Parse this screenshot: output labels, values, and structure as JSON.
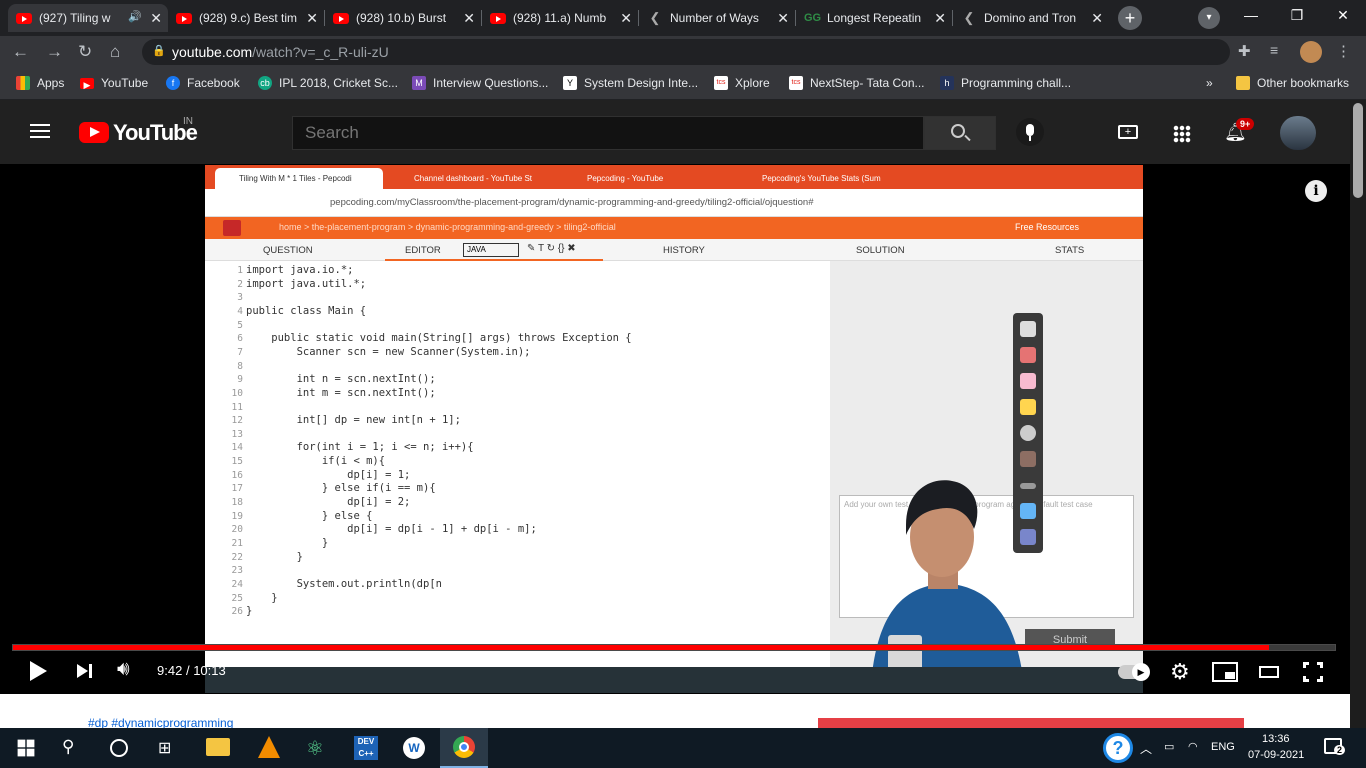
{
  "browser": {
    "tabs": [
      {
        "title": "(927) Tiling w",
        "icon": "youtube-icon"
      },
      {
        "title": "(928) 9.c) Best tim",
        "icon": "youtube-icon"
      },
      {
        "title": "(928) 10.b) Burst",
        "icon": "youtube-icon"
      },
      {
        "title": "(928) 11.a) Numb",
        "icon": "youtube-icon"
      },
      {
        "title": "Number of Ways",
        "icon": "pepcoding-icon"
      },
      {
        "title": "Longest Repeatin",
        "icon": "geeksforgeeks-icon"
      },
      {
        "title": "Domino and Tron",
        "icon": "pepcoding-icon"
      }
    ],
    "url_host": "youtube.com",
    "url_path": "/watch?v=_c_R-uli-zU",
    "bookmarks": [
      {
        "label": "Apps",
        "color": "#e8eaed"
      },
      {
        "label": "YouTube",
        "color": "#ff0000"
      },
      {
        "label": "Facebook",
        "color": "#1877f2"
      },
      {
        "label": "IPL 2018, Cricket Sc...",
        "color": "#11a683"
      },
      {
        "label": "Interview Questions...",
        "color": "#7b4bb7"
      },
      {
        "label": "System Design Inte...",
        "color": "#ffffff"
      },
      {
        "label": "Xplore",
        "color": "#e2231a"
      },
      {
        "label": "NextStep- Tata Con...",
        "color": "#e2231a"
      },
      {
        "label": "Programming chall...",
        "color": "#24335a"
      }
    ],
    "more_bookmarks": "»",
    "other_bookmarks": "Other bookmarks"
  },
  "youtube": {
    "logo_text": "YouTube",
    "region": "IN",
    "search_placeholder": "Search",
    "notification_badge": "9+",
    "time_current": "9:42",
    "time_sep": "/",
    "time_total": "10:13",
    "progress_fraction": 0.95,
    "hashtags": "#dp #dynamicprogramming"
  },
  "video": {
    "tabs": [
      "Tiling With M * 1 Tiles - Pepcodi",
      "Channel dashboard - YouTube St",
      "Pepcoding - YouTube",
      "Pepcoding's YouTube Stats (Sum"
    ],
    "url": "pepcoding.com/myClassroom/the-placement-program/dynamic-programming-and-greedy/tiling2-official/ojquestion#",
    "breadcrumb": "home > the-placement-program > dynamic-programming-and-greedy > tiling2-official",
    "free_resources": "Free Resources",
    "sub_tabs": [
      "QUESTION",
      "EDITOR",
      "HISTORY",
      "SOLUTION",
      "STATS"
    ],
    "language": "JAVA",
    "stdin_placeholder": "Add your own test cases or run your program against default test case",
    "submit": "Submit",
    "code_lines": [
      {
        "n": "1",
        "t": "import java.io.*;"
      },
      {
        "n": "2",
        "t": "import java.util.*;"
      },
      {
        "n": "3",
        "t": ""
      },
      {
        "n": "4",
        "t": "public class Main {"
      },
      {
        "n": "5",
        "t": ""
      },
      {
        "n": "6",
        "t": "    public static void main(String[] args) throws Exception {"
      },
      {
        "n": "7",
        "t": "        Scanner scn = new Scanner(System.in);"
      },
      {
        "n": "8",
        "t": ""
      },
      {
        "n": "9",
        "t": "        int n = scn.nextInt();"
      },
      {
        "n": "10",
        "t": "        int m = scn.nextInt();"
      },
      {
        "n": "11",
        "t": ""
      },
      {
        "n": "12",
        "t": "        int[] dp = new int[n + 1];"
      },
      {
        "n": "13",
        "t": ""
      },
      {
        "n": "14",
        "t": "        for(int i = 1; i <= n; i++){"
      },
      {
        "n": "15",
        "t": "            if(i < m){"
      },
      {
        "n": "16",
        "t": "                dp[i] = 1;"
      },
      {
        "n": "17",
        "t": "            } else if(i == m){"
      },
      {
        "n": "18",
        "t": "                dp[i] = 2;"
      },
      {
        "n": "19",
        "t": "            } else {"
      },
      {
        "n": "20",
        "t": "                dp[i] = dp[i - 1] + dp[i - m];"
      },
      {
        "n": "21",
        "t": "            }"
      },
      {
        "n": "22",
        "t": "        }"
      },
      {
        "n": "23",
        "t": ""
      },
      {
        "n": "24",
        "t": "        System.out.println(dp[n"
      },
      {
        "n": "25",
        "t": "    }"
      },
      {
        "n": "26",
        "t": "}"
      }
    ]
  },
  "taskbar": {
    "lang": "ENG",
    "time": "13:36",
    "date": "07-09-2021",
    "notifications": "2"
  }
}
